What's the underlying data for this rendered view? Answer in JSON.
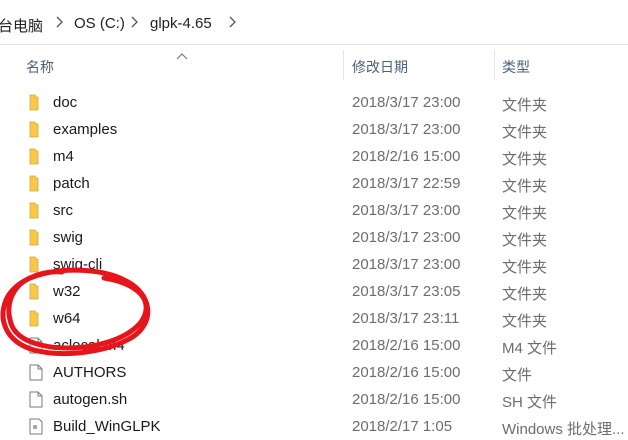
{
  "address_bar": {
    "crumbs": [
      "台电脑",
      "OS (C:)",
      "glpk-4.65"
    ]
  },
  "columns": {
    "name": "名称",
    "modified": "修改日期",
    "type": "类型"
  },
  "files": [
    {
      "name": "doc",
      "modified": "2018/3/17 23:00",
      "type": "文件夹",
      "icon": "folder-icon"
    },
    {
      "name": "examples",
      "modified": "2018/3/17 23:00",
      "type": "文件夹",
      "icon": "folder-icon"
    },
    {
      "name": "m4",
      "modified": "2018/2/16 15:00",
      "type": "文件夹",
      "icon": "folder-icon"
    },
    {
      "name": "patch",
      "modified": "2018/3/17 22:59",
      "type": "文件夹",
      "icon": "folder-icon"
    },
    {
      "name": "src",
      "modified": "2018/3/17 23:00",
      "type": "文件夹",
      "icon": "folder-icon"
    },
    {
      "name": "swig",
      "modified": "2018/3/17 23:00",
      "type": "文件夹",
      "icon": "folder-icon"
    },
    {
      "name": "swig-cli",
      "modified": "2018/3/17 23:00",
      "type": "文件夹",
      "icon": "folder-icon"
    },
    {
      "name": "w32",
      "modified": "2018/3/17 23:05",
      "type": "文件夹",
      "icon": "folder-icon"
    },
    {
      "name": "w64",
      "modified": "2018/3/17 23:11",
      "type": "文件夹",
      "icon": "folder-icon"
    },
    {
      "name": "aclocal.m4",
      "modified": "2018/2/16 15:00",
      "type": "M4 文件",
      "icon": "file-icon"
    },
    {
      "name": "AUTHORS",
      "modified": "2018/2/16 15:00",
      "type": "文件",
      "icon": "file-icon"
    },
    {
      "name": "autogen.sh",
      "modified": "2018/2/16 15:00",
      "type": "SH 文件",
      "icon": "file-icon"
    },
    {
      "name": "Build_WinGLPK",
      "modified": "2018/2/17 1:05",
      "type": "Windows 批处理...",
      "icon": "batch-file-icon"
    }
  ],
  "colors": {
    "folder": "#f6c94c",
    "annotation": "#e8141c"
  }
}
